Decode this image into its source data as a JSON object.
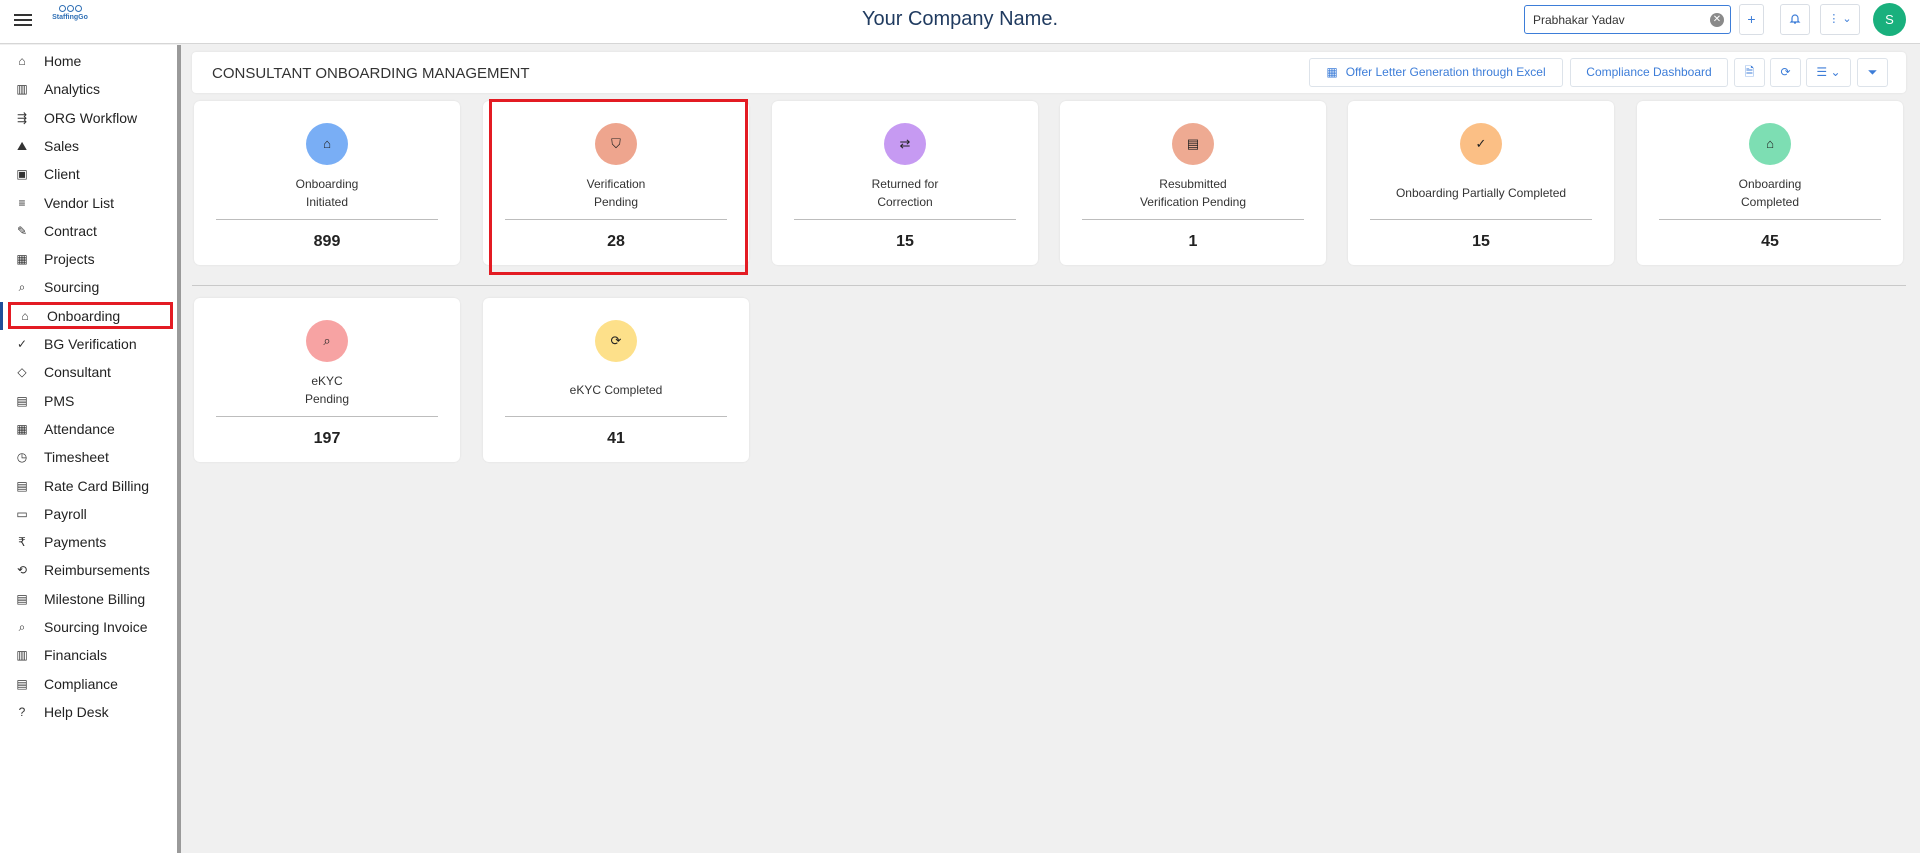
{
  "topbar": {
    "logo_text": "StaffingGo",
    "company_name": "Your Company Name.",
    "search_value": "Prabhakar Yadav",
    "avatar_initial": "S"
  },
  "sidebar": {
    "items": [
      {
        "label": "Home",
        "icon": "home-icon"
      },
      {
        "label": "Analytics",
        "icon": "analytics-icon"
      },
      {
        "label": "ORG Workflow",
        "icon": "workflow-icon"
      },
      {
        "label": "Sales",
        "icon": "sales-icon"
      },
      {
        "label": "Client",
        "icon": "client-icon"
      },
      {
        "label": "Vendor List",
        "icon": "vendor-list-icon"
      },
      {
        "label": "Contract",
        "icon": "contract-icon"
      },
      {
        "label": "Projects",
        "icon": "projects-icon"
      },
      {
        "label": "Sourcing",
        "icon": "sourcing-icon"
      },
      {
        "label": "Onboarding",
        "icon": "onboarding-icon"
      },
      {
        "label": "BG Verification",
        "icon": "bg-verification-icon"
      },
      {
        "label": "Consultant",
        "icon": "consultant-icon"
      },
      {
        "label": "PMS",
        "icon": "pms-icon"
      },
      {
        "label": "Attendance",
        "icon": "attendance-icon"
      },
      {
        "label": "Timesheet",
        "icon": "timesheet-icon"
      },
      {
        "label": "Rate Card Billing",
        "icon": "rate-card-icon"
      },
      {
        "label": "Payroll",
        "icon": "payroll-icon"
      },
      {
        "label": "Payments",
        "icon": "rupee-icon"
      },
      {
        "label": "Reimbursements",
        "icon": "reimbursements-icon"
      },
      {
        "label": "Milestone Billing",
        "icon": "milestone-icon"
      },
      {
        "label": "Sourcing Invoice",
        "icon": "invoice-icon"
      },
      {
        "label": "Financials",
        "icon": "financials-icon"
      },
      {
        "label": "Compliance",
        "icon": "compliance-icon"
      },
      {
        "label": "Help Desk",
        "icon": "help-icon"
      }
    ],
    "active": "Onboarding"
  },
  "header": {
    "title": "CONSULTANT ONBOARDING MANAGEMENT",
    "offer_letter_label": "Offer Letter Generation through Excel",
    "compliance_dashboard_label": "Compliance Dashboard"
  },
  "cards": [
    {
      "label": "Onboarding\nInitiated",
      "count": "899",
      "color": "#79aef5",
      "icon": "home-upload-icon"
    },
    {
      "label": "Verification\nPending",
      "count": "28",
      "color": "#eea58e",
      "icon": "shield-icon"
    },
    {
      "label": "Returned for\nCorrection",
      "count": "15",
      "color": "#c69af2",
      "icon": "return-arrows-icon"
    },
    {
      "label": "Resubmitted\nVerification Pending",
      "count": "1",
      "color": "#eeaa92",
      "icon": "clipboard-icon"
    },
    {
      "label": "Onboarding Partially Completed",
      "count": "15",
      "color": "#fbbf85",
      "icon": "partial-check-icon"
    },
    {
      "label": "Onboarding\nCompleted",
      "count": "45",
      "color": "#7ddeb3",
      "icon": "home-check-icon"
    },
    {
      "label": "eKYC\nPending",
      "count": "197",
      "color": "#f7a3a3",
      "icon": "search-badge-icon"
    },
    {
      "label": "eKYC Completed",
      "count": "41",
      "color": "#fde08a",
      "icon": "sync-check-icon"
    }
  ]
}
